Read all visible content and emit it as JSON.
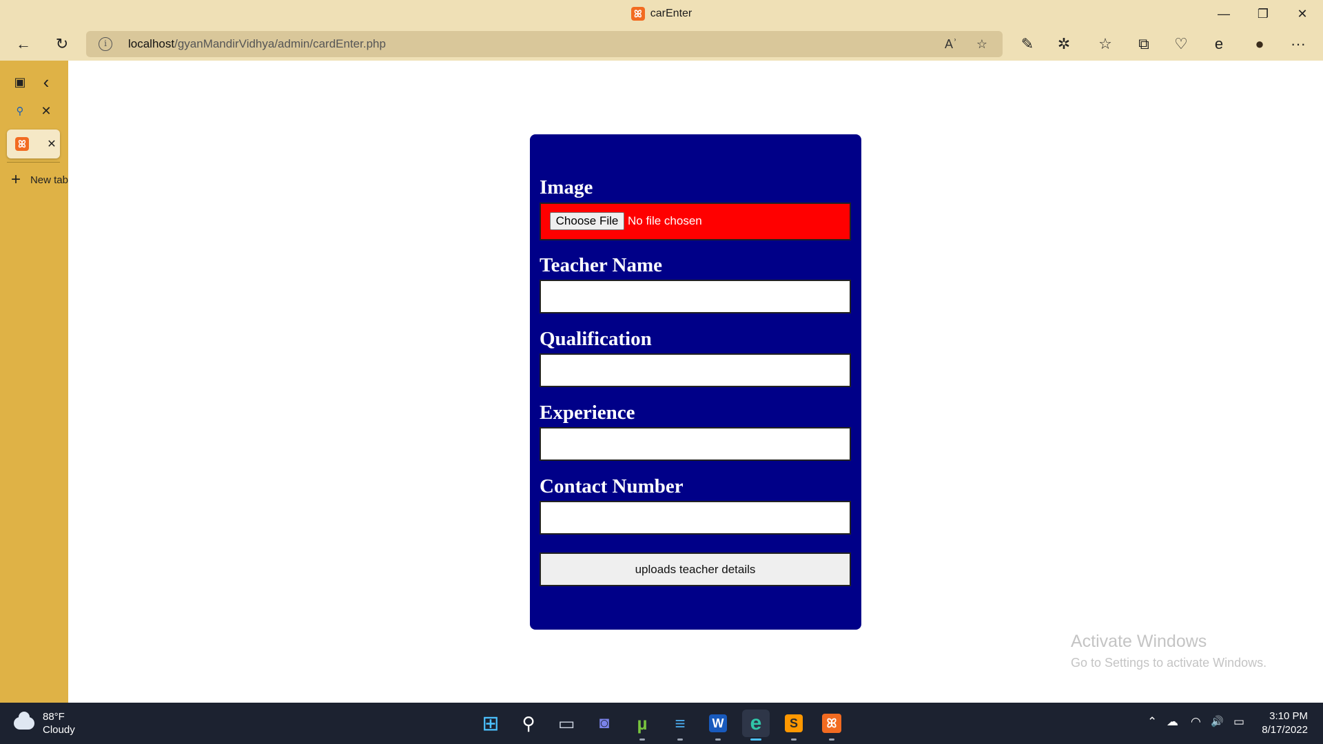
{
  "window": {
    "title": "carEnter",
    "tab_icon_glyph": "ꕤ",
    "minimize_glyph": "—",
    "restore_glyph": "❐",
    "close_glyph": "✕"
  },
  "toolbar": {
    "back_glyph": "←",
    "refresh_glyph": "↻",
    "address_info_glyph": "i",
    "address_host": "localhost",
    "address_path": "/gyanMandirVidhya/admin/cardEnter.php",
    "read_aloud_glyph": "Aʾ",
    "add_favorite_glyph": "☆",
    "extension_glyph": "✎",
    "extensions_glyph": "✲",
    "favorites_glyph": "☆",
    "collections_glyph": "⧉",
    "health_glyph": "♡",
    "ie_mode_glyph": "e",
    "profile_glyph": "●",
    "more_glyph": "···"
  },
  "sidebar": {
    "tab_actions_glyph": "▣",
    "collapse_glyph": "‹",
    "search_glyph": "⚲",
    "search_close_glyph": "✕",
    "active_tab_close_glyph": "✕",
    "new_tab_plus": "+",
    "new_tab_label": "New tab"
  },
  "form": {
    "image_label": "Image",
    "choose_file_label": "Choose File",
    "no_file_text": "No file chosen",
    "teacher_name_label": "Teacher Name",
    "teacher_name_value": "",
    "qualification_label": "Qualification",
    "qualification_value": "",
    "experience_label": "Experience",
    "experience_value": "",
    "contact_label": "Contact Number",
    "contact_value": "",
    "submit_label": "uploads teacher details"
  },
  "watermark": {
    "line1": "Activate Windows",
    "line2": "Go to Settings to activate Windows."
  },
  "taskbar": {
    "weather_temp": "88°F",
    "weather_desc": "Cloudy",
    "start_glyph": "⊞",
    "search_glyph": "⚲",
    "taskview_glyph": "▭",
    "chat_glyph": "◙",
    "utorrent_glyph": "µ",
    "notepad_glyph": "≡",
    "word_glyph": "W",
    "edge_glyph": "e",
    "sublime_glyph": "S",
    "xampp_glyph": "ꕤ",
    "tray_up_glyph": "⌃",
    "tray_onedrive_glyph": "☁",
    "tray_wifi_glyph": "◠",
    "tray_volume_glyph": "🔊",
    "tray_battery_glyph": "▭",
    "time": "3:10 PM",
    "date": "8/17/2022"
  },
  "colors": {
    "card_background": "#000088",
    "file_box_background": "#ff0000",
    "browser_chrome": "#efe0b6",
    "sidebar": "#dfb246",
    "taskbar": "#1c2230"
  }
}
